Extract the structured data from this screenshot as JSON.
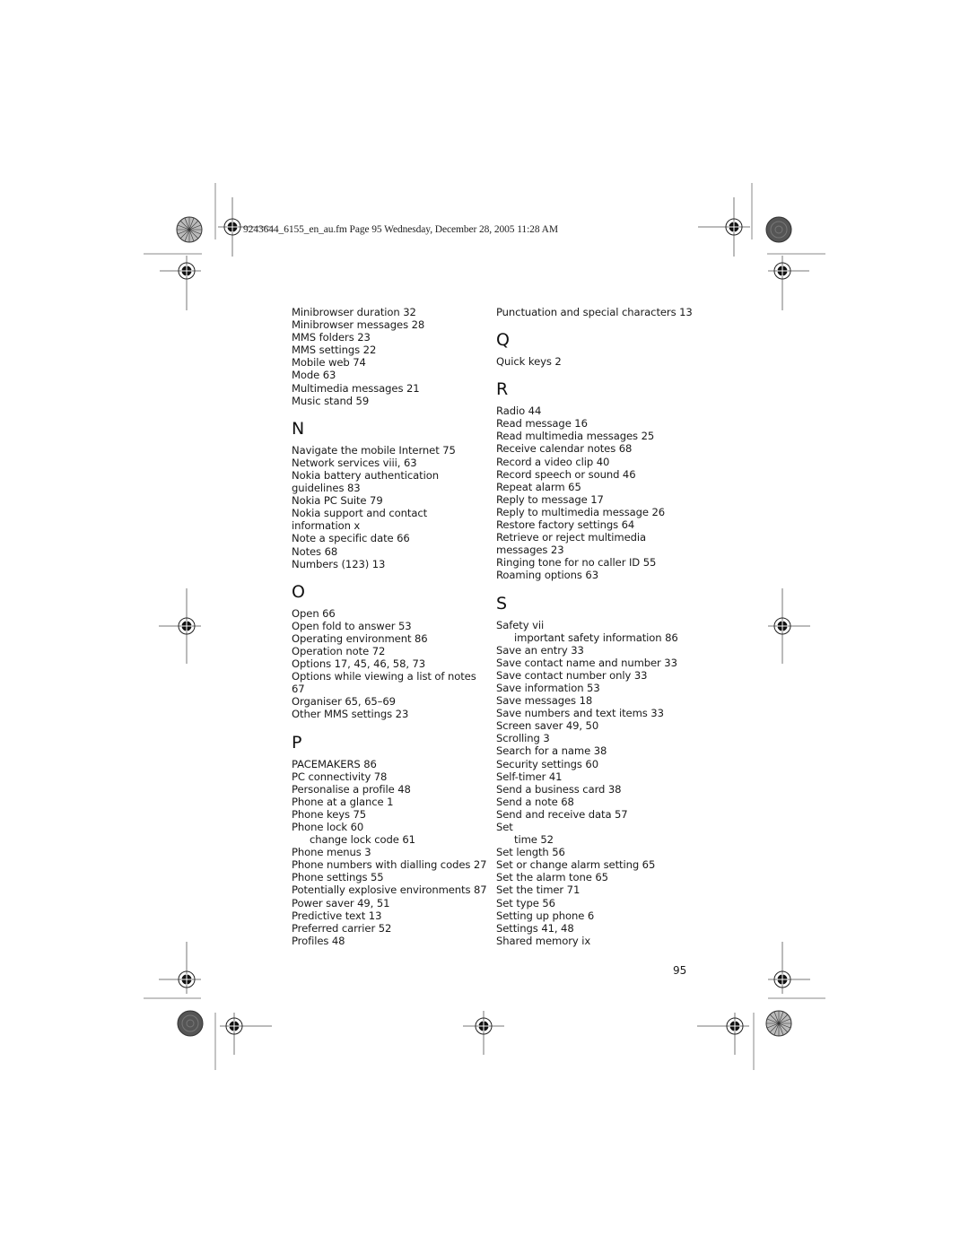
{
  "header": {
    "text": "9243644_6155_en_au.fm  Page 95  Wednesday, December 28, 2005  11:28 AM"
  },
  "index": {
    "left_column": {
      "pre_entries": [
        {
          "text": "Minibrowser duration 32"
        },
        {
          "text": "Minibrowser messages 28"
        },
        {
          "text": "MMS folders 23"
        },
        {
          "text": "MMS settings 22"
        },
        {
          "text": "Mobile web 74"
        },
        {
          "text": "Mode 63"
        },
        {
          "text": "Multimedia messages 21"
        },
        {
          "text": "Music stand 59"
        }
      ],
      "sections": [
        {
          "letter": "N",
          "entries": [
            {
              "text": "Navigate the mobile Internet 75"
            },
            {
              "text": "Network services viii, 63"
            },
            {
              "text": "Nokia battery authentication"
            },
            {
              "text": "guidelines 83"
            },
            {
              "text": "Nokia PC Suite 79"
            },
            {
              "text": "Nokia support and contact"
            },
            {
              "text": "information x"
            },
            {
              "text": "Note a specific date 66"
            },
            {
              "text": "Notes 68"
            },
            {
              "text": "Numbers (123) 13"
            }
          ]
        },
        {
          "letter": "O",
          "entries": [
            {
              "text": "Open 66"
            },
            {
              "text": "Open fold to answer 53"
            },
            {
              "text": "Operating environment 86"
            },
            {
              "text": "Operation note 72"
            },
            {
              "text": "Options 17, 45, 46, 58, 73"
            },
            {
              "text": "Options while viewing a list of notes"
            },
            {
              "text": "67"
            },
            {
              "text": "Organiser 65, 65–69"
            },
            {
              "text": "Other MMS settings 23"
            }
          ]
        },
        {
          "letter": "P",
          "entries": [
            {
              "text": "PACEMAKERS 86"
            },
            {
              "text": "PC connectivity 78"
            },
            {
              "text": "Personalise a profile 48"
            },
            {
              "text": "Phone at a glance 1"
            },
            {
              "text": "Phone keys 75"
            },
            {
              "text": "Phone lock 60"
            },
            {
              "text": "change lock code 61",
              "sub": true
            },
            {
              "text": "Phone menus 3"
            },
            {
              "text": "Phone numbers with dialling codes 27"
            },
            {
              "text": "Phone settings 55"
            },
            {
              "text": "Potentially explosive environments 87"
            },
            {
              "text": "Power saver 49, 51"
            },
            {
              "text": "Predictive text 13"
            },
            {
              "text": "Preferred carrier 52"
            },
            {
              "text": "Profiles 48"
            }
          ]
        }
      ]
    },
    "right_column": {
      "pre_entries": [
        {
          "text": "Punctuation and special characters 13"
        }
      ],
      "sections": [
        {
          "letter": "Q",
          "entries": [
            {
              "text": "Quick keys 2"
            }
          ]
        },
        {
          "letter": "R",
          "entries": [
            {
              "text": "Radio 44"
            },
            {
              "text": "Read message 16"
            },
            {
              "text": "Read multimedia messages 25"
            },
            {
              "text": "Receive calendar notes 68"
            },
            {
              "text": "Record a video clip 40"
            },
            {
              "text": "Record speech or sound 46"
            },
            {
              "text": "Repeat alarm 65"
            },
            {
              "text": "Reply to message 17"
            },
            {
              "text": "Reply to multimedia message 26"
            },
            {
              "text": "Restore factory settings 64"
            },
            {
              "text": "Retrieve or reject multimedia"
            },
            {
              "text": "messages 23"
            },
            {
              "text": "Ringing tone for no caller ID 55"
            },
            {
              "text": "Roaming options 63"
            }
          ]
        },
        {
          "letter": "S",
          "entries": [
            {
              "text": "Safety vii"
            },
            {
              "text": "important safety information 86",
              "sub": true
            },
            {
              "text": "Save an entry 33"
            },
            {
              "text": "Save contact name and number 33"
            },
            {
              "text": "Save contact number only 33"
            },
            {
              "text": "Save information 53"
            },
            {
              "text": "Save messages 18"
            },
            {
              "text": "Save numbers and text items 33"
            },
            {
              "text": "Screen saver 49, 50"
            },
            {
              "text": "Scrolling 3"
            },
            {
              "text": "Search for a name 38"
            },
            {
              "text": "Security settings 60"
            },
            {
              "text": "Self-timer 41"
            },
            {
              "text": "Send a business card 38"
            },
            {
              "text": "Send a note 68"
            },
            {
              "text": "Send and receive data 57"
            },
            {
              "text": "Set"
            },
            {
              "text": "time 52",
              "sub": true
            },
            {
              "text": "Set length 56"
            },
            {
              "text": "Set or change alarm setting 65"
            },
            {
              "text": "Set the alarm tone 65"
            },
            {
              "text": "Set the timer 71"
            },
            {
              "text": "Set type 56"
            },
            {
              "text": "Setting up phone 6"
            },
            {
              "text": "Settings 41, 48"
            },
            {
              "text": "Shared memory ix"
            }
          ]
        }
      ]
    }
  },
  "footer": {
    "page_number": "95"
  }
}
